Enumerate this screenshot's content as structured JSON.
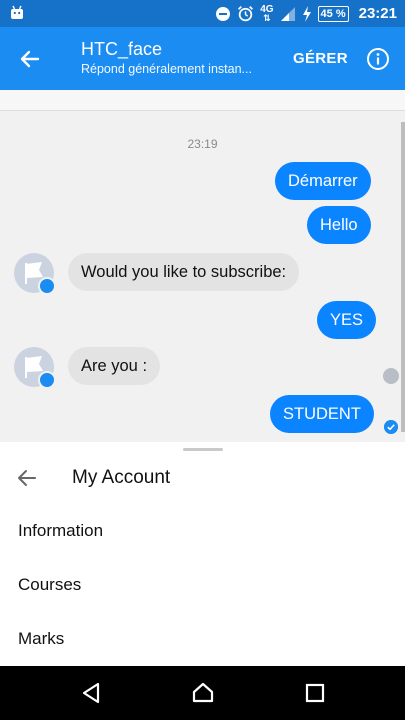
{
  "status_bar": {
    "time": "23:21",
    "battery": "45 %",
    "network": "4G",
    "icons": [
      "android-icon",
      "dnd-icon",
      "alarm-icon",
      "data-arrows-icon",
      "signal-icon",
      "charging-icon"
    ]
  },
  "header": {
    "title": "HTC_face",
    "subtitle": "Répond généralement instan...",
    "manage_label": "GÉRER",
    "icons": [
      "back-arrow-icon",
      "info-icon"
    ],
    "colors": {
      "app_bar": "#1a8cf2",
      "status_bar": "#1672c9"
    }
  },
  "chat": {
    "timestamp": "23:19",
    "messages": [
      {
        "from": "me",
        "text": "Démarrer"
      },
      {
        "from": "me",
        "text": "Hello"
      },
      {
        "from": "bot",
        "text": "Would you like to subscribe:"
      },
      {
        "from": "me",
        "text": "YES"
      },
      {
        "from": "bot",
        "text": "Are you :"
      },
      {
        "from": "me",
        "text": "STUDENT"
      }
    ],
    "colors": {
      "outgoing": "#0a84ff",
      "incoming": "#e3e3e3"
    }
  },
  "menu": {
    "title": "My Account",
    "items": [
      "Information",
      "Courses",
      "Marks"
    ]
  },
  "nav_bar": {
    "icons": [
      "back-triangle-icon",
      "home-circle-icon",
      "recents-square-icon"
    ]
  }
}
